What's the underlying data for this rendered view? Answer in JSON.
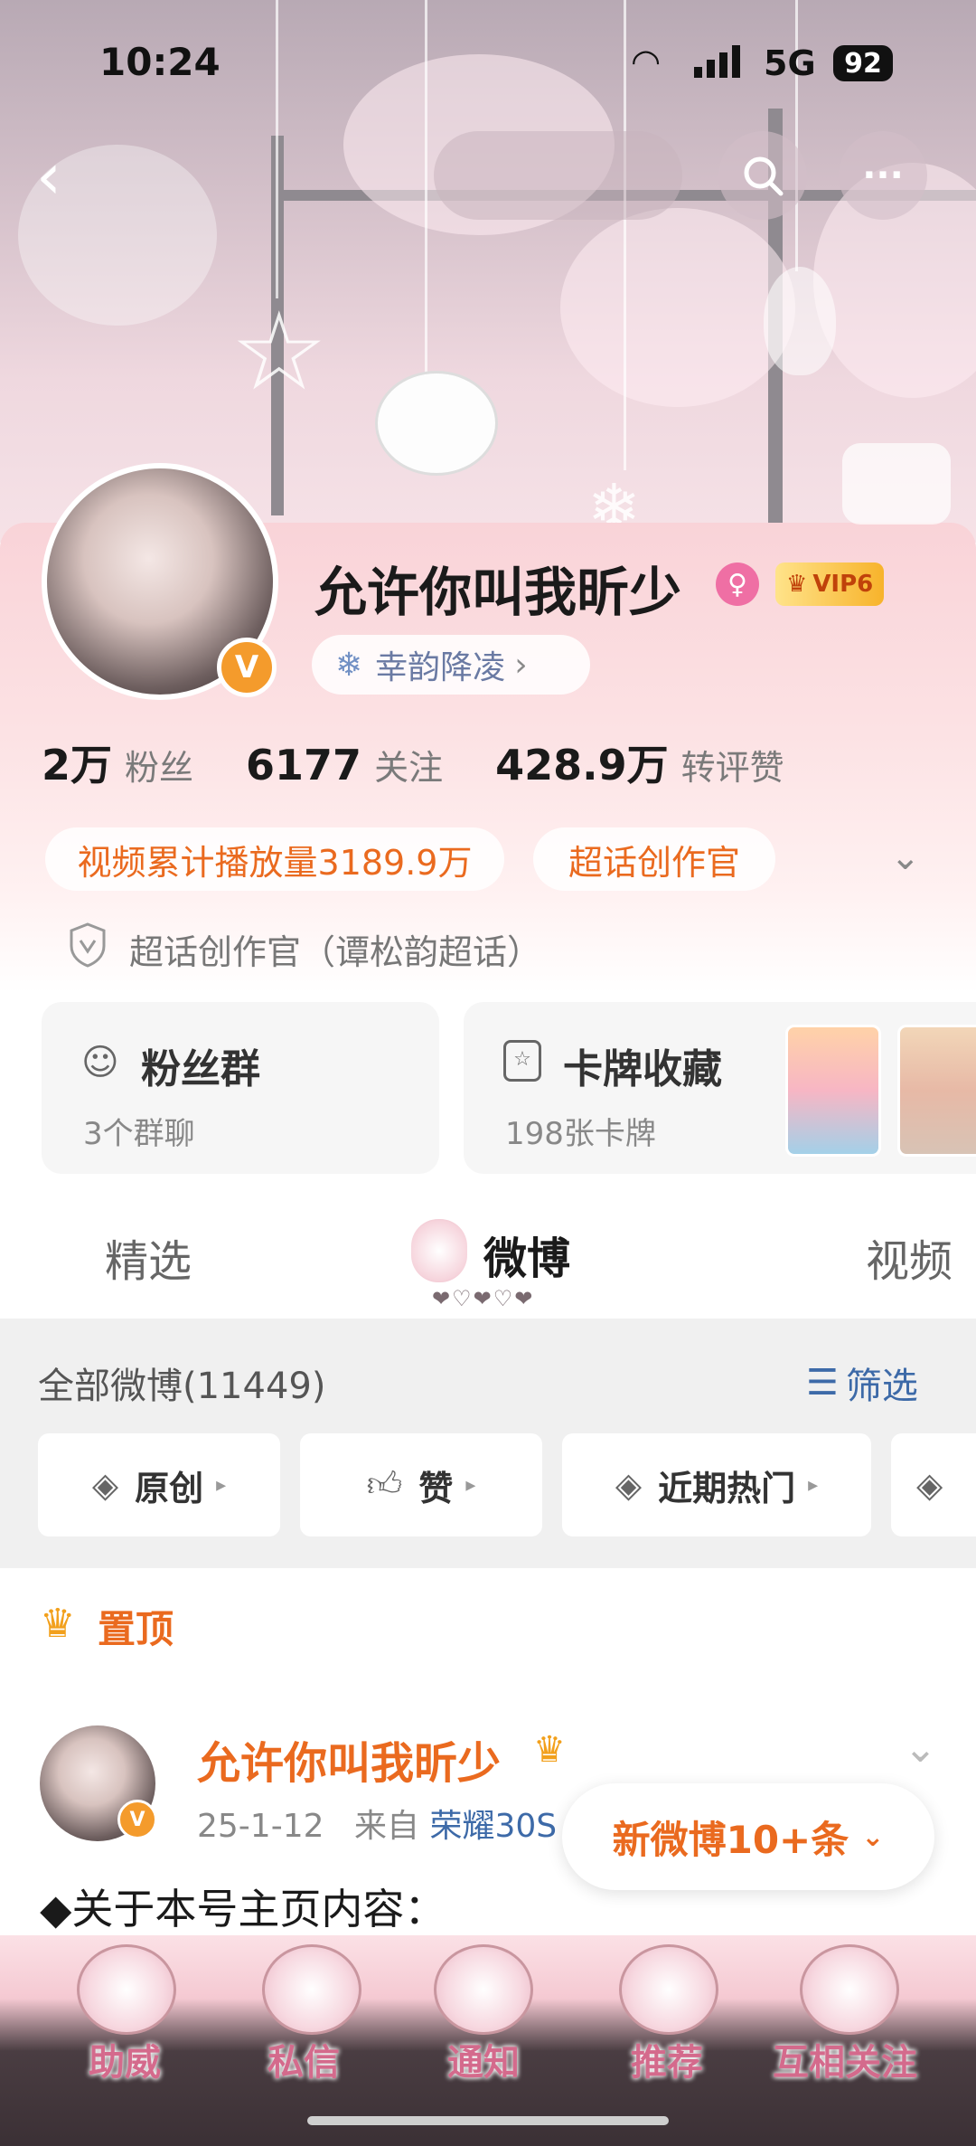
{
  "status_bar": {
    "time": "10:24",
    "network": "5G",
    "battery": "92"
  },
  "profile": {
    "name": "允许你叫我昕少",
    "vip_level": "VIP6",
    "verified_mark": "V",
    "group_tag": "幸韵降凌",
    "stats": [
      {
        "value": "2万",
        "label": "粉丝"
      },
      {
        "value": "6177",
        "label": "关注"
      },
      {
        "value": "428.9万",
        "label": "转评赞"
      }
    ],
    "badges": [
      "视频累计播放量3189.9万",
      "超话创作官"
    ],
    "role": "超话创作官（谭松韵超话）"
  },
  "cards": {
    "fans_group": {
      "title": "粉丝群",
      "subtitle": "3个群聊"
    },
    "card_collection": {
      "title": "卡牌收藏",
      "subtitle": "198张卡牌"
    }
  },
  "tabs": {
    "featured": "精选",
    "weibo": "微博",
    "video": "视频",
    "active": "weibo"
  },
  "feed": {
    "all_label": "全部微博(11449)",
    "filter_button": "筛选",
    "filters": [
      "原创",
      "赞",
      "近期热门"
    ],
    "pinned_label": "置顶"
  },
  "post": {
    "author": "允许你叫我昕少",
    "date": "25-1-12",
    "source_prefix": "来自",
    "source": "荣耀30S",
    "text": "◆关于本号主页内容："
  },
  "toast": {
    "text": "新微博10+条"
  },
  "bottom_nav": [
    "助威",
    "私信",
    "通知",
    "推荐",
    "互相关注"
  ],
  "colors": {
    "accent_orange": "#ea6a1f",
    "link_blue": "#3d6aa8",
    "profile_pink": "#f9d3d8"
  }
}
